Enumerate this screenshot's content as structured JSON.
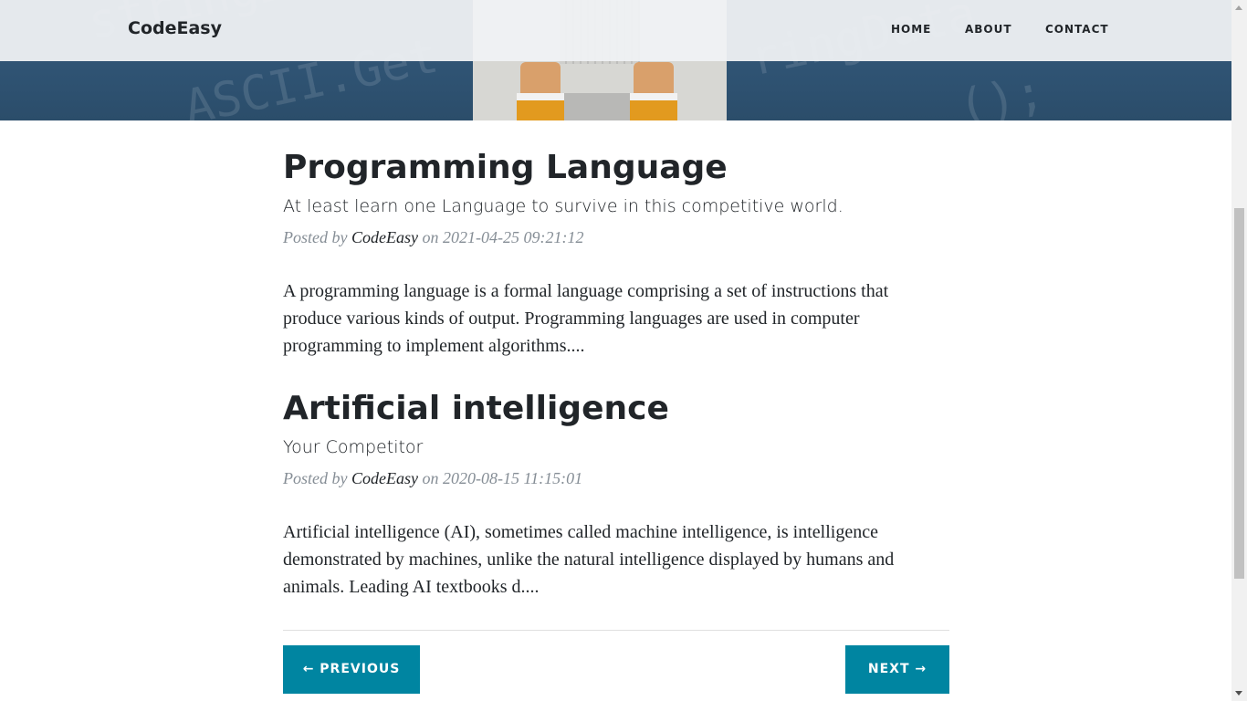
{
  "navbar": {
    "brand": "CodeEasy",
    "items": [
      "HOME",
      "ABOUT",
      "CONTACT"
    ]
  },
  "hero": {
    "code_lines": [
      "stringDa",
      "ASCII.Get",
      "ringData",
      "();"
    ]
  },
  "posts": [
    {
      "title": "Programming Language",
      "subtitle": "At least learn one Language to survive in this competitive world.",
      "meta_prefix": "Posted by",
      "author": "CodeEasy",
      "meta_on": "on",
      "date": "2021-04-25 09:21:12",
      "excerpt": "A programming language is a formal language comprising a set of instructions that produce various kinds of output. Programming languages are used in computer programming to implement algorithms...."
    },
    {
      "title": "Artificial intelligence",
      "subtitle": "Your Competitor",
      "meta_prefix": "Posted by",
      "author": "CodeEasy",
      "meta_on": "on",
      "date": "2020-08-15 11:15:01",
      "excerpt": "Artificial intelligence (AI), sometimes called machine intelligence, is intelligence demonstrated by machines, unlike the natural intelligence displayed by humans and animals. Leading AI textbooks d...."
    }
  ],
  "pager": {
    "previous": "← PREVIOUS",
    "next": "NEXT →"
  },
  "colors": {
    "accent": "#0085a1",
    "text": "#212529",
    "muted": "#868e96"
  }
}
